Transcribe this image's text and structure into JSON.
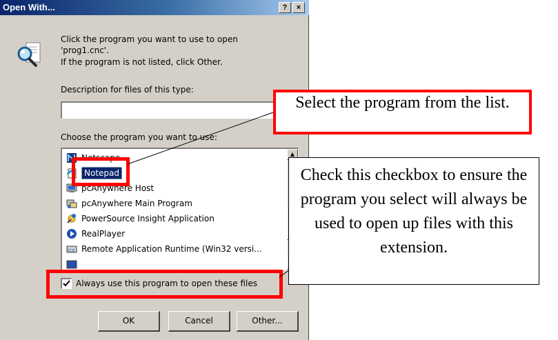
{
  "dialog": {
    "title": "Open With...",
    "help_button": "?",
    "close_button": "×",
    "intro_line1": "Click the program you want to use to open",
    "intro_line2": "'prog1.cnc'.",
    "intro_line3": "If the program is not listed, click Other.",
    "description_label": "Description for files of this type:",
    "description_value": "",
    "choose_label": "Choose the program you want to use:",
    "programs": [
      {
        "label": "Netscape",
        "icon": "netscape-icon"
      },
      {
        "label": "Notepad",
        "icon": "notepad-icon",
        "selected": true
      },
      {
        "label": "pcAnywhere Host",
        "icon": "pcanywhere-host-icon"
      },
      {
        "label": "pcAnywhere Main Program",
        "icon": "pcanywhere-icon"
      },
      {
        "label": "PowerSource Insight Application",
        "icon": "powersource-icon"
      },
      {
        "label": "RealPlayer",
        "icon": "realplayer-icon"
      },
      {
        "label": "Remote Application Runtime (Win32 versi...",
        "icon": "remote-app-icon"
      }
    ],
    "always_use_label": "Always use this program to open these files",
    "always_use_checked": true,
    "ok_label": "OK",
    "cancel_label": "Cancel",
    "other_label": "Other..."
  },
  "callouts": {
    "select_program": "Select the program from the list.",
    "checkbox_hint": "Check this checkbox to ensure the program you select will always be used to open up files with this extension."
  },
  "colors": {
    "title_start": "#0a246a",
    "title_end": "#a6caf0",
    "selection": "#0a246a",
    "highlight_box": "#ff0000",
    "dialog_face": "#d4d0c8"
  }
}
